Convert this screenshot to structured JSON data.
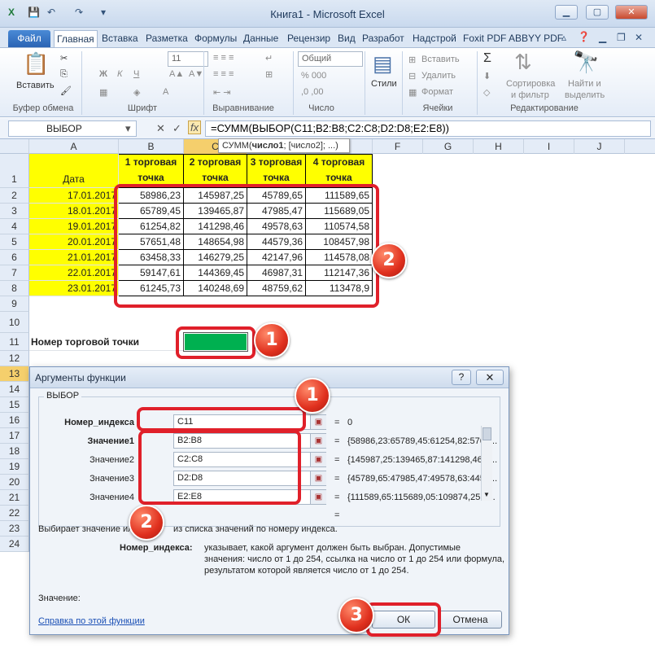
{
  "window": {
    "title": "Книга1 - Microsoft Excel"
  },
  "ribbon_tabs": [
    "Файл",
    "Главная",
    "Вставка",
    "Разметка",
    "Формулы",
    "Данные",
    "Рецензир",
    "Вид",
    "Разработ",
    "Надстрой",
    "Foxit PDF",
    "ABBYY PDF"
  ],
  "ribbon": {
    "paste": "Вставить",
    "font_size": "11",
    "number_format": "Общий",
    "styles": "Стили",
    "insert": "Вставить",
    "delete": "Удалить",
    "format": "Формат",
    "sigma": "Σ",
    "sort": "Сортировка\nи фильтр",
    "sort_l1": "Сортировка",
    "sort_l2": "и фильтр",
    "find_l1": "Найти и",
    "find_l2": "выделить",
    "groups": [
      "Буфер обмена",
      "Шрифт",
      "Выравнивание",
      "Число",
      "Ячейки",
      "Редактирование"
    ]
  },
  "formula_bar": {
    "name_box": "ВЫБОР",
    "fx": "fx",
    "formula": "=СУММ(ВЫБОР(C11;B2:B8;C2:C8;D2:D8;E2:E8))",
    "tooltip_func": "СУММ(",
    "tooltip_arg1": "число1",
    "tooltip_rest": "; [число2]; ...)"
  },
  "columns": [
    "A",
    "B",
    "C",
    "D",
    "E",
    "F",
    "G",
    "H",
    "I",
    "J"
  ],
  "rows": [
    "1",
    "2",
    "3",
    "4",
    "5",
    "6",
    "7",
    "8",
    "9",
    "10",
    "11",
    "12",
    "13",
    "14",
    "15",
    "16",
    "17",
    "18",
    "19",
    "20",
    "21",
    "22",
    "23",
    "24"
  ],
  "table": {
    "header_a": "Дата",
    "headers": [
      "1 торговая точка",
      "2 торговая точка",
      "3 торговая точка",
      "4 торговая точка"
    ],
    "header_l1": [
      "1 торговая",
      "2 торговая",
      "3 торговая",
      "4 торговая"
    ],
    "header_l2": [
      "точка",
      "точка",
      "точка",
      "точка"
    ],
    "dates": [
      "17.01.2017",
      "18.01.2017",
      "19.01.2017",
      "20.01.2017",
      "21.01.2017",
      "22.01.2017",
      "23.01.2017"
    ],
    "values": [
      [
        "58986,23",
        "145987,25",
        "45789,65",
        "111589,65"
      ],
      [
        "65789,45",
        "139465,87",
        "47985,47",
        "115689,05"
      ],
      [
        "61254,82",
        "141298,46",
        "49578,63",
        "110574,58"
      ],
      [
        "57651,48",
        "148654,98",
        "44579,36",
        "108457,98"
      ],
      [
        "63458,33",
        "146279,25",
        "42147,96",
        "114578,08"
      ],
      [
        "59147,61",
        "144369,45",
        "46987,31",
        "112147,36"
      ],
      [
        "61245,73",
        "140248,69",
        "48759,62",
        "113478,9"
      ]
    ],
    "row11_label": "Номер торговой точки"
  },
  "dialog": {
    "title": "Аргументы функции",
    "help": "?",
    "close": "✕",
    "function_name": "ВЫБОР",
    "args": [
      {
        "label": "Номер_индекса",
        "value": "C11",
        "result": "0"
      },
      {
        "label": "Значение1",
        "value": "B2:B8",
        "result": "{58986,23:65789,45:61254,82:5765..."
      },
      {
        "label": "Значение2",
        "value": "C2:C8",
        "result": "{145987,25:139465,87:141298,46:1..."
      },
      {
        "label": "Значение3",
        "value": "D2:D8",
        "result": "{45789,65:47985,47:49578,63:4457..."
      },
      {
        "label": "Значение4",
        "value": "E2:E8",
        "result": "{111589,65:115689,05:109874,25:1..."
      }
    ],
    "eq": "=",
    "description_part1": "Выбирает значение ил",
    "description_part2": "из списка значений по номеру индекса.",
    "param_name": "Номер_индекса:",
    "param_desc_l1": "указывает, какой аргумент должен быть выбран. Допустимые",
    "param_desc_l2": "значения: число от 1 до 254, ссылка на число от 1 до 254 или формула,",
    "param_desc_l3": "результатом которой является число от 1 до 254.",
    "value_label": "Значение:",
    "help_link": "Справка по этой функции",
    "ok": "ОК",
    "cancel": "Отмена"
  },
  "badges": [
    "1",
    "2",
    "1",
    "2",
    "3"
  ],
  "colors": {
    "yellow": "#ffff00",
    "green": "#00b050",
    "red_frame": "#e0202a"
  }
}
